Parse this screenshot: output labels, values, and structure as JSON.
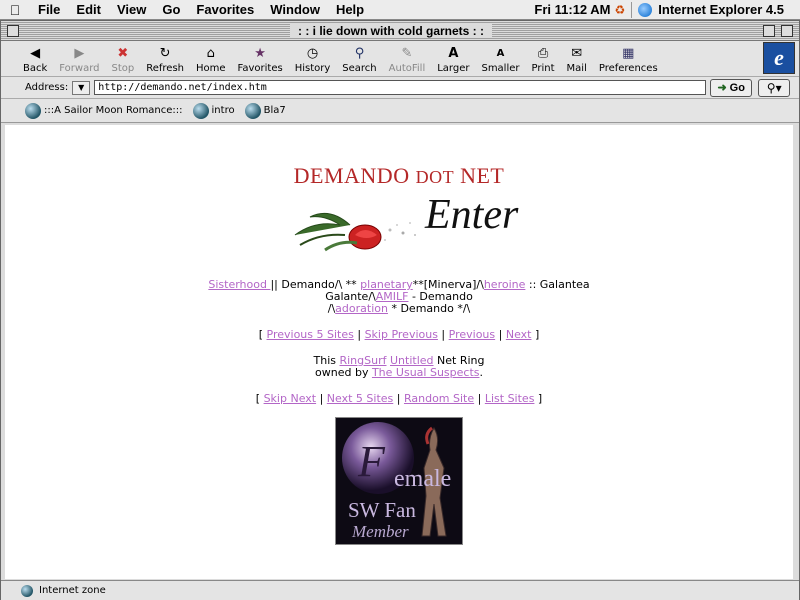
{
  "menubar": {
    "items": [
      "File",
      "Edit",
      "View",
      "Go",
      "Favorites",
      "Window",
      "Help"
    ],
    "clock": "Fri 11:12 AM",
    "app_name": "Internet Explorer 4.5"
  },
  "window": {
    "title": ": : i lie down with cold garnets : :"
  },
  "toolbar": {
    "buttons": [
      {
        "label": "Back",
        "icon": "back-arrow-icon",
        "enabled": true
      },
      {
        "label": "Forward",
        "icon": "forward-arrow-icon",
        "enabled": false
      },
      {
        "label": "Stop",
        "icon": "stop-icon",
        "enabled": false
      },
      {
        "label": "Refresh",
        "icon": "refresh-icon",
        "enabled": true
      },
      {
        "label": "Home",
        "icon": "home-icon",
        "enabled": true
      },
      {
        "label": "Favorites",
        "icon": "favorites-icon",
        "enabled": true
      },
      {
        "label": "History",
        "icon": "history-icon",
        "enabled": true
      },
      {
        "label": "Search",
        "icon": "search-icon",
        "enabled": true
      },
      {
        "label": "AutoFill",
        "icon": "autofill-icon",
        "enabled": false
      },
      {
        "label": "Larger",
        "icon": "text-larger-icon",
        "enabled": true
      },
      {
        "label": "Smaller",
        "icon": "text-smaller-icon",
        "enabled": true
      },
      {
        "label": "Print",
        "icon": "print-icon",
        "enabled": true
      },
      {
        "label": "Mail",
        "icon": "mail-icon",
        "enabled": true
      },
      {
        "label": "Preferences",
        "icon": "preferences-icon",
        "enabled": true
      }
    ]
  },
  "address": {
    "label": "Address:",
    "url": "http://demando.net/index.htm",
    "go_label": "Go"
  },
  "favorites_bar": {
    "items": [
      ":::A Sailor Moon Romance:::",
      "intro",
      "Bla7"
    ]
  },
  "page": {
    "title_part1": "DEMANDO ",
    "title_part2": "DOT",
    "title_part3": " NET",
    "enter_text": "Enter",
    "ring": {
      "sisterhood": "Sisterhood ",
      "t1": " || Demando/\\ ** ",
      "planetary": "planetary",
      "t2": "**[Minerva]/\\",
      "heroine": "heroine",
      "t3": " :: Galantea",
      "t4": "Galante/\\",
      "amilf": "AMILF",
      "t5": " - Demando",
      "t6": "/\\",
      "adoration": "adoration",
      "t7": " * Demando */\\"
    },
    "nav1": {
      "open": "[ ",
      "prev5": "Previous 5 Sites",
      "skip_prev": "Skip Previous",
      "previous": "Previous",
      "next": "Next",
      "close": " ]",
      "sep": " | "
    },
    "ringsurf": {
      "t1": "This ",
      "ringsurf": "RingSurf",
      "untitled": "Untitled",
      "t2": " Net Ring",
      "t3": "owned by ",
      "suspects": "The Usual Suspects",
      "t4": "."
    },
    "nav2": {
      "open": "[ ",
      "skip_next": "Skip Next",
      "next5": "Next 5 Sites",
      "random": "Random Site",
      "list": "List Sites",
      "close": " ]",
      "sep": " | "
    },
    "badge": {
      "line1": "emale",
      "line2": "SW Fan",
      "line3": "Member"
    }
  },
  "status": {
    "zone": "Internet zone"
  }
}
